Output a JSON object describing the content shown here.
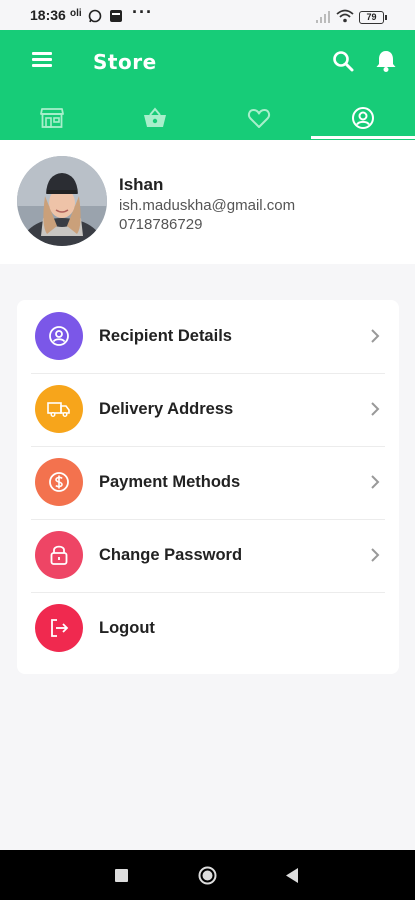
{
  "status_bar": {
    "time": "18:36",
    "battery": "79"
  },
  "app_bar": {
    "title": "Store",
    "tabs": [
      {
        "id": "store",
        "icon": "storefront-icon"
      },
      {
        "id": "basket",
        "icon": "basket-icon"
      },
      {
        "id": "wishlist",
        "icon": "heart-icon"
      },
      {
        "id": "profile",
        "icon": "profile-icon",
        "selected": true
      }
    ],
    "color": "#17cc78"
  },
  "profile": {
    "name": "Ishan",
    "email": "ish.maduskha@gmail.com",
    "phone": "0718786729"
  },
  "menu": {
    "items": [
      {
        "label": "Recipient Details",
        "icon": "user-circle-icon",
        "color": "#7b57e8",
        "chevron": true
      },
      {
        "label": "Delivery Address",
        "icon": "truck-icon",
        "color": "#f7a51b",
        "chevron": true
      },
      {
        "label": "Payment Methods",
        "icon": "dollar-icon",
        "color": "#f3724e",
        "chevron": true
      },
      {
        "label": "Change Password",
        "icon": "lock-icon",
        "color": "#ee4565",
        "chevron": true
      },
      {
        "label": "Logout",
        "icon": "logout-icon",
        "color": "#f0294f",
        "chevron": false
      }
    ]
  }
}
